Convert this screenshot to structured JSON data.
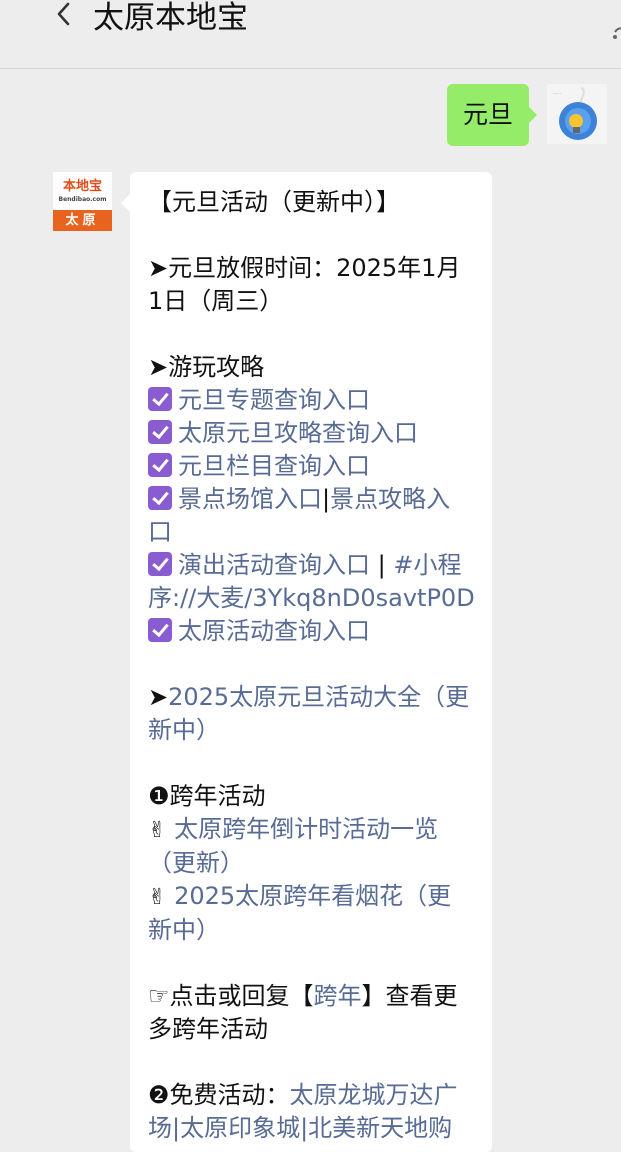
{
  "header": {
    "title": "太原本地宝"
  },
  "chat": {
    "outgoing_text": "元旦",
    "bot_logo_top": "本地宝",
    "bot_logo_domain": "Bendibao.com",
    "bot_logo_bottom": "太原",
    "message": {
      "heading": "【元旦活动（更新中）】",
      "holiday_label": "➤元旦放假时间：2025年1月",
      "holiday_date": "1日（周三）",
      "guide_title": "➤游玩攻略",
      "links": [
        "元旦专题查询入口",
        "太原元旦攻略查询入口",
        "元旦栏目查询入口"
      ],
      "scenic_a": "景点场馆入口",
      "scenic_sep": "|",
      "scenic_b_1": "景点攻略入",
      "scenic_b_2": "口",
      "show_link": "演出活动查询入口",
      "show_sep": " | ",
      "miniprogram_1": "#小程",
      "miniprogram_2": "序://大麦/3Ykq8nD0savtP0D",
      "activity_link": "太原活动查询入口",
      "arrow": "➤",
      "all_link_1": "2025太原元旦活动大全（更",
      "all_link_2": "新中）",
      "kuanian_title": "❶跨年活动",
      "kuanian_emoji": "✌",
      "kuanian_link1_1": "太原跨年倒计时活动一览",
      "kuanian_link1_2": "（更新）",
      "kuanian_link2_1": "2025太原跨年看烟花（更",
      "kuanian_link2_2": "新中）",
      "reply_prefix": "☞点击或回复【",
      "reply_keyword": "跨年",
      "reply_suffix": "】查看更",
      "reply_line2": "多跨年活动",
      "free_title": "❷免费活动：",
      "free_link_1": "太原龙城万达广",
      "free_link_2": "场|太原印象城|北美新天地购"
    }
  }
}
